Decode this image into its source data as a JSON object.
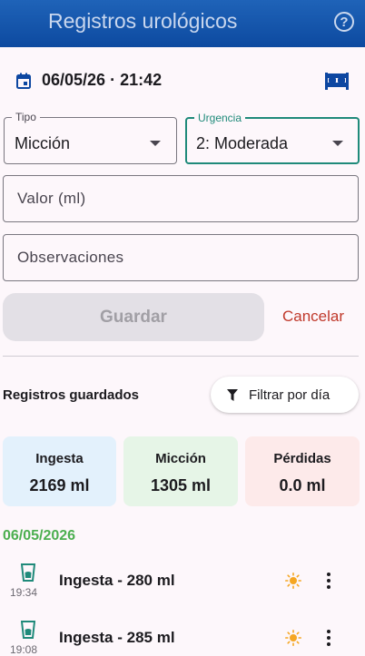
{
  "appbar": {
    "title": "Registros urológicos",
    "help_icon": "help-circle-icon"
  },
  "datetime": {
    "value": "06/05/26 · 21:42",
    "icon": "calendar-icon",
    "bed_icon": "bed-icon"
  },
  "form": {
    "tipo": {
      "label": "Tipo",
      "value": "Micción"
    },
    "urgencia": {
      "label": "Urgencia",
      "value": "2: Moderada"
    },
    "valor": {
      "placeholder": "Valor (ml)"
    },
    "observaciones": {
      "placeholder": "Observaciones"
    },
    "save_label": "Guardar",
    "cancel_label": "Cancelar"
  },
  "records": {
    "title": "Registros guardados",
    "filter_label": "Filtrar por día",
    "summary": [
      {
        "title": "Ingesta",
        "value": "2169 ml",
        "color": "#e3f1fc"
      },
      {
        "title": "Micción",
        "value": "1305 ml",
        "color": "#e6f5e7"
      },
      {
        "title": "Pérdidas",
        "value": "0.0 ml",
        "color": "#fdeaea"
      }
    ],
    "date_header": "06/05/2026",
    "entries": [
      {
        "time": "19:34",
        "title": "Ingesta - 280 ml",
        "icon": "cup-icon",
        "status_icon": "sun-icon"
      },
      {
        "time": "19:08",
        "title": "Ingesta - 285 ml",
        "icon": "cup-icon",
        "status_icon": "sun-icon"
      }
    ]
  },
  "colors": {
    "appbar": "#1f63b8",
    "accent": "#1f8a7a",
    "cancel": "#c0392b",
    "date_header": "#4caf50",
    "icon": "#1f8a7a",
    "sun": "#f5a623"
  }
}
